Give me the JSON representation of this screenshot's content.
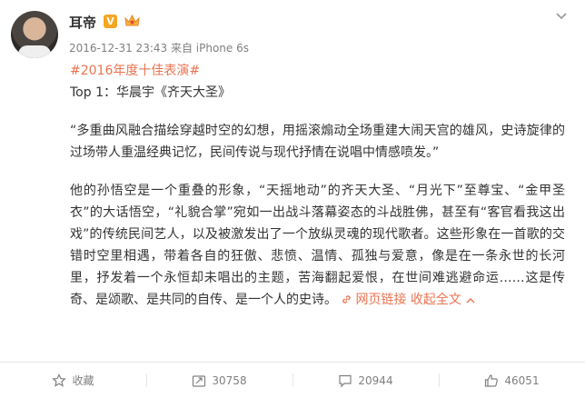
{
  "post": {
    "author": "耳帝",
    "verified_badge": "V",
    "timestamp": "2016-12-31 23:43",
    "source": "来自 iPhone 6s",
    "topic": "#2016年度十佳表演#",
    "headline": "Top 1：华晨宇《齐天大圣》",
    "quote": "“多重曲风融合描绘穿越时空的幻想，用摇滚煽动全场重建大闹天宫的雄风，史诗旋律的过场带人重温经典记忆，民间传说与现代抒情在说唱中情感喷发。”",
    "body": "他的孙悟空是一个重叠的形象，“天摇地动”的齐天大圣、“月光下”至尊宝、“金甲圣衣”的大话悟空，“礼貌合掌”宛如一出战斗落幕姿态的斗战胜佛，甚至有“客官看我这出戏”的传统民间艺人，以及被激发出了一个放纵灵魂的现代歌者。这些形象在一首歌的交错时空里相遇，带着各自的狂傲、悲愤、温情、孤独与爱意，像是在一条永世的长河里，抒发着一个永恒却未唱出的主题，苦海翻起爱恨，在世间难逃避命运……这是传奇、是颂歌、是共同的自传、是一个人的史诗。",
    "web_link_label": "网页链接",
    "collapse_label": "收起全文",
    "accent_color": "#eb7350"
  },
  "actions": {
    "favorite_label": "收藏",
    "repost_count": "30758",
    "comment_count": "20944",
    "like_count": "46051"
  }
}
